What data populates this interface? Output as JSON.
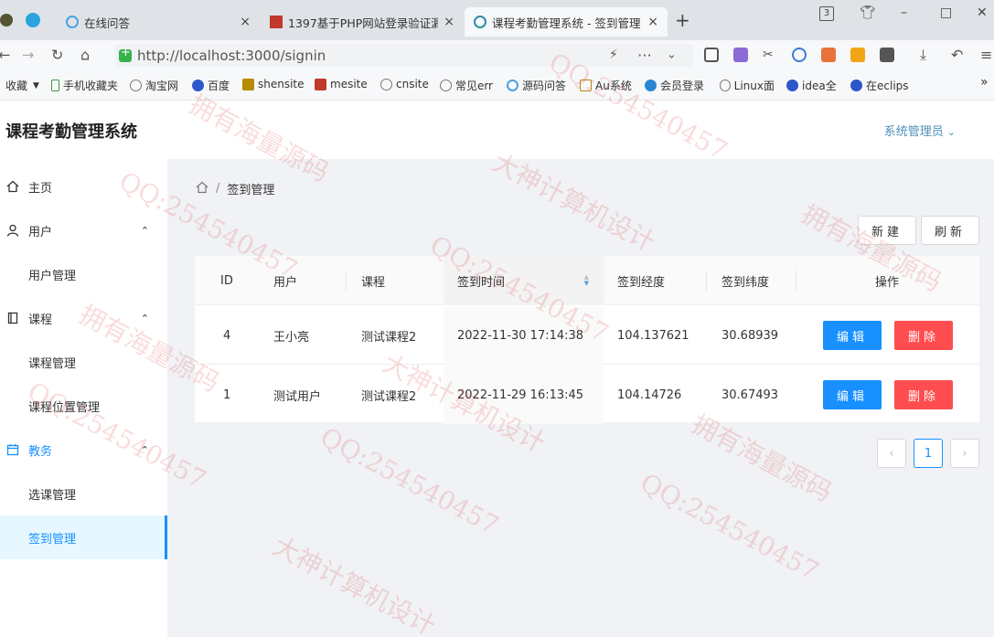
{
  "browser": {
    "tabs": [
      {
        "title": "在线问答",
        "close": "×",
        "active": false
      },
      {
        "title": "1397基于PHP网站登录验证漏",
        "close": "×",
        "active": false
      },
      {
        "title": "课程考勤管理系统 - 签到管理",
        "close": "×",
        "active": true
      }
    ],
    "new_tab": "+",
    "window_badge": "3",
    "address": "http://localhost:3000/signin",
    "bookmarks": [
      "收藏",
      "手机收藏夹",
      "淘宝网",
      "百度",
      "shensite",
      "mesite",
      "cnsite",
      "常见err",
      "源码问答",
      "Au系统",
      "会员登录",
      "Linux面",
      "idea全",
      "在eclips"
    ],
    "colors": {
      "tab_bar": "#dfe3e8",
      "toolbar": "#f7f8fa"
    }
  },
  "app": {
    "title": "课程考勤管理系统",
    "user_menu": "系统管理员",
    "sidebar": {
      "items": [
        {
          "label": "主页",
          "icon": "home-icon",
          "type": "item"
        },
        {
          "label": "用户",
          "icon": "user-icon",
          "type": "group"
        },
        {
          "label": "用户管理",
          "type": "sub"
        },
        {
          "label": "课程",
          "icon": "book-icon",
          "type": "group"
        },
        {
          "label": "课程管理",
          "type": "sub"
        },
        {
          "label": "课程位置管理",
          "type": "sub"
        },
        {
          "label": "教务",
          "icon": "calendar-icon",
          "type": "group"
        },
        {
          "label": "选课管理",
          "type": "sub"
        },
        {
          "label": "签到管理",
          "type": "sub",
          "active": true
        }
      ]
    },
    "breadcrumb": {
      "current": "签到管理",
      "separator": "/"
    },
    "toolbar": {
      "new_label": "新建",
      "refresh_label": "刷新"
    },
    "table": {
      "columns": [
        "ID",
        "用户",
        "课程",
        "签到时间",
        "签到经度",
        "签到纬度",
        "操作"
      ],
      "sorted_column": "签到时间",
      "rows": [
        {
          "id": "4",
          "user": "王小亮",
          "course": "测试课程2",
          "time": "2022-11-30 17:14:38",
          "lng": "104.137621",
          "lat": "30.68939"
        },
        {
          "id": "1",
          "user": "测试用户",
          "course": "测试课程2",
          "time": "2022-11-29 16:13:45",
          "lng": "104.14726",
          "lat": "30.67493"
        }
      ],
      "edit_label": "编辑",
      "delete_label": "删除"
    },
    "pagination": {
      "prev": "‹",
      "current": "1",
      "next": "›"
    },
    "colors": {
      "primary": "#1890ff",
      "danger": "#ff4d4f",
      "content_bg": "#f0f2f5"
    }
  },
  "watermarks": [
    "QQ:254540457",
    "拥有海量源码",
    "大神计算机设计"
  ]
}
